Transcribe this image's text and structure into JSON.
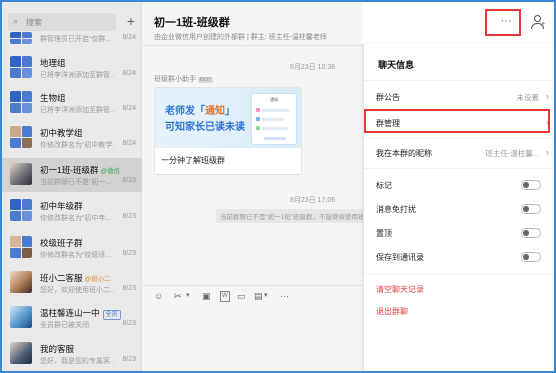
{
  "sidebar": {
    "search_placeholder": "搜索",
    "plus_label": "+",
    "top_item": {
      "preview": "群管理员已开启“仅群...",
      "date": "8/24"
    },
    "items": [
      {
        "name": "地理组",
        "preview": "已将李洋洲添加至群管...",
        "date": "8/24",
        "avatar": "grid"
      },
      {
        "name": "生物组",
        "preview": "已将李洋洲添加至群管...",
        "date": "8/24",
        "avatar": "grid"
      },
      {
        "name": "初中教学组",
        "preview": "你修改群名为“初中教学...",
        "date": "8/24",
        "avatar": "photo-grid"
      },
      {
        "name": "初一1班-班级群",
        "tag": "@微信",
        "preview": "当前群聊已不是“初一...",
        "date": "8/23",
        "avatar": "photo-man",
        "selected": true
      },
      {
        "name": "初中年级群",
        "preview": "你修改群名为“初中年...",
        "date": "8/23",
        "avatar": "grid"
      },
      {
        "name": "校级班子群",
        "preview": "你修改群名为“校级班...",
        "date": "8/23",
        "avatar": "photo-grid2"
      },
      {
        "name": "班小二客服",
        "tag": "@班小二",
        "preview": "您好，欢迎使用班小二...",
        "date": "8/23",
        "avatar": "photo-woman"
      },
      {
        "name": "温柱馨连山一中",
        "tag": "全员",
        "preview": "全员群已被关闭",
        "date": "8/23",
        "avatar": "photo-blue"
      },
      {
        "name": "我的客服",
        "preview": "您好，我是您的专属客...",
        "date": "8/23",
        "avatar": "photo-man2"
      }
    ]
  },
  "chat": {
    "title": "初一1班-班级群",
    "subtitle": "由企业微信用户创建的外部群 | 群主: 班主任-温柱馨老师",
    "time1": "8月23日 10:36",
    "sender": "班级群小助手",
    "sender_tag": "BOT",
    "card": {
      "line1_prefix": "老师发「",
      "line1_highlight": "通知",
      "line1_suffix": "」",
      "line2": "可知家长已读未读",
      "phone_title": "通知",
      "caption": "一分钟了解班级群"
    },
    "time2": "8月23日 17:06",
    "system_message": "当前群聊已不是“初一1班”班级群，不能继续使用班级群功能",
    "toolbar": {
      "emoji": "☺",
      "scissors": "✂",
      "image": "▣",
      "word": "W",
      "folder": "▭",
      "more": "···"
    }
  },
  "header_buttons": {
    "more": "···",
    "user_add": "+"
  },
  "panel": {
    "title": "聊天信息",
    "rows": [
      {
        "key": "announcement",
        "label": "群公告",
        "value": "未设置",
        "type": "chevron"
      },
      {
        "key": "manage",
        "label": "群管理",
        "value": "",
        "type": "chevron"
      },
      {
        "key": "nickname",
        "label": "我在本群的昵称",
        "value": "班主任-温柱馨...",
        "type": "chevron"
      },
      {
        "key": "star",
        "label": "标记",
        "type": "toggle"
      },
      {
        "key": "mute",
        "label": "消息免打扰",
        "type": "toggle"
      },
      {
        "key": "pin",
        "label": "置顶",
        "type": "toggle"
      },
      {
        "key": "save",
        "label": "保存到通讯录",
        "type": "toggle"
      }
    ],
    "clear_history": "清空聊天记录",
    "exit_group": "退出群聊"
  }
}
